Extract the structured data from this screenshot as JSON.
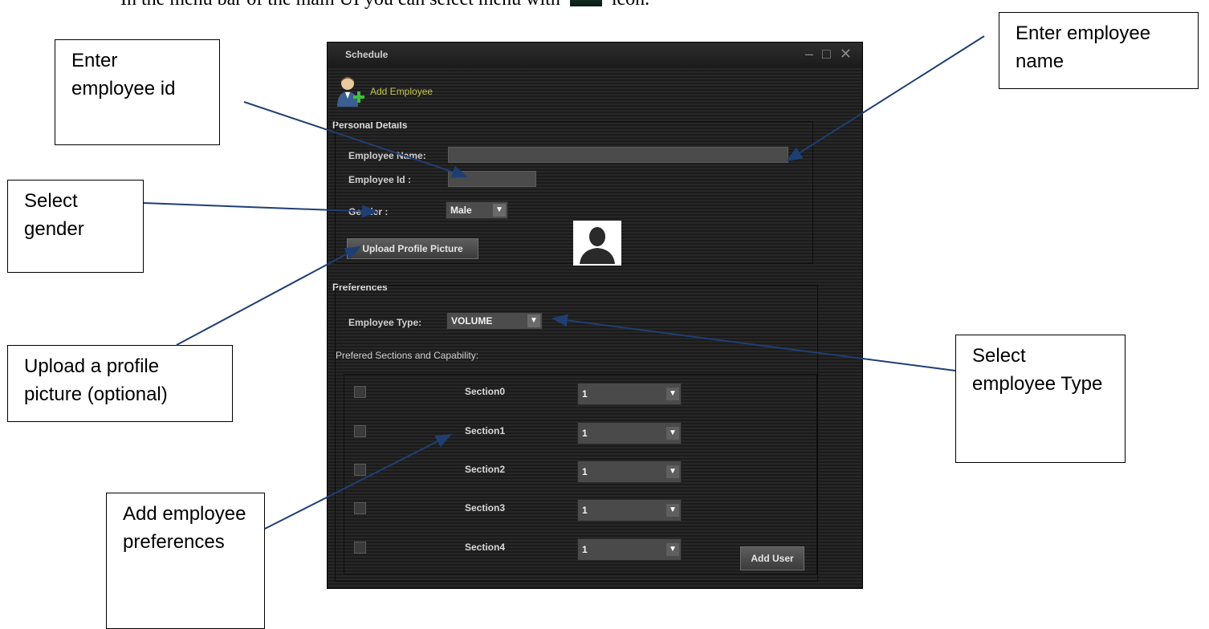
{
  "caption": {
    "before": "In the menu bar of the main UI you can select menu with",
    "after": "icon."
  },
  "callouts": {
    "employee_id": "Enter employee id",
    "employee_name": "Enter employee name",
    "gender": "Select gender",
    "profile_picture": "Upload a profile picture (optional)",
    "employee_type": "Select employee Type",
    "preferences": "Add employee preferences"
  },
  "window": {
    "title": "Schedule",
    "controls": {
      "minimize": "–",
      "maximize": "□",
      "close": "✕"
    },
    "heading": "Add Employee",
    "personal_details": {
      "title": "Personal Details",
      "name_label": "Employee Name:",
      "name_value": "",
      "id_label": "Employee Id   :",
      "id_value": "",
      "gender_label": "Gender       :",
      "gender_value": "Male",
      "upload_button": "Upload Profile Picture"
    },
    "preferences": {
      "title": "Preferences",
      "type_label": "Employee Type:",
      "type_value": "VOLUME",
      "sections_title": "Prefered Sections and Capability:",
      "sections": [
        {
          "label": "Section0",
          "capability": "1",
          "checked": false
        },
        {
          "label": "Section1",
          "capability": "1",
          "checked": false
        },
        {
          "label": "Section2",
          "capability": "1",
          "checked": false
        },
        {
          "label": "Section3",
          "capability": "1",
          "checked": false
        },
        {
          "label": "Section4",
          "capability": "1",
          "checked": false
        }
      ],
      "add_button": "Add User"
    }
  },
  "colors": {
    "window_bg": "#222222",
    "heading_accent": "#c9c84a",
    "arrow": "#1f3f73"
  }
}
